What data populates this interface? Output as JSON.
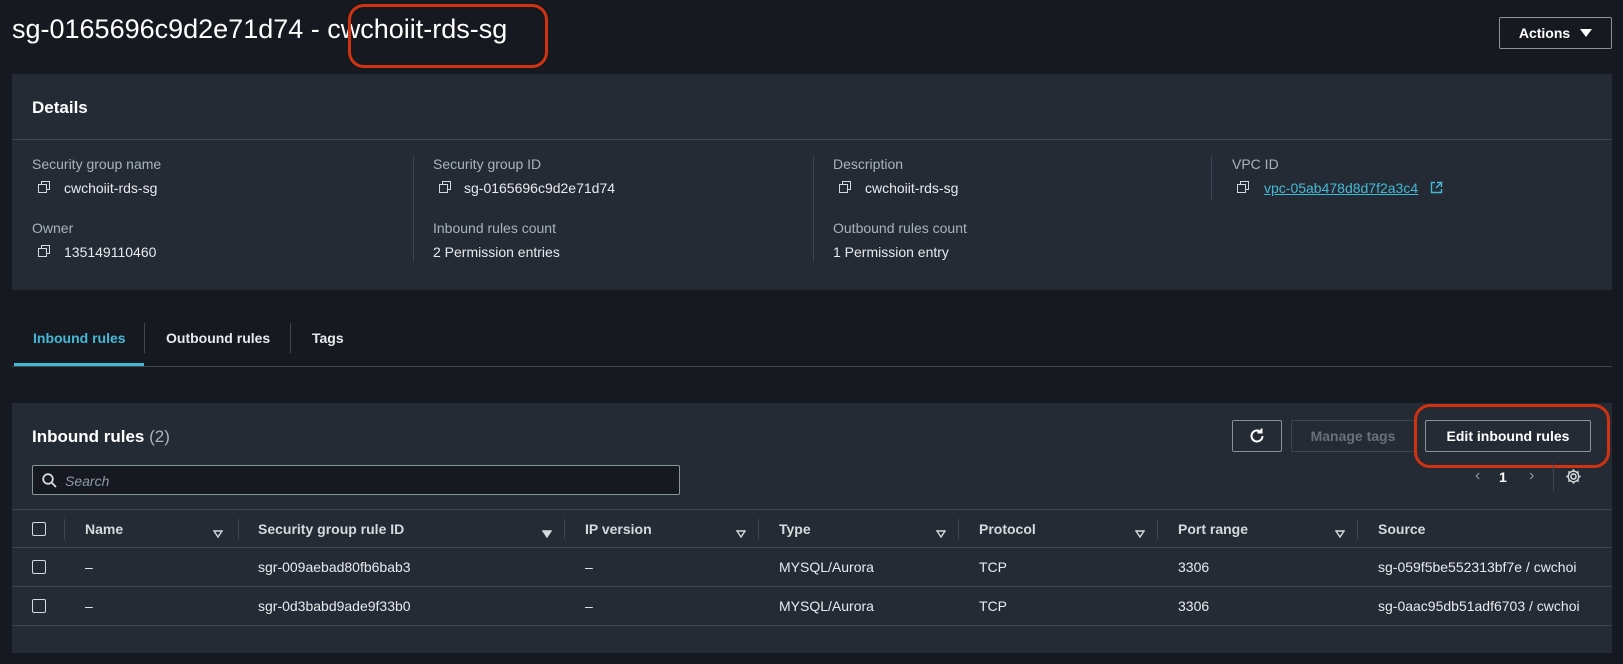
{
  "page": {
    "title_id": "sg-0165696c9d2e71d74 - ",
    "title_name": "cwchoiit-rds-sg",
    "actions_label": "Actions"
  },
  "details": {
    "heading": "Details",
    "fields": [
      {
        "label": "Security group name",
        "value": "cwchoiit-rds-sg"
      },
      {
        "label": "Security group ID",
        "value": "sg-0165696c9d2e71d74"
      },
      {
        "label": "Description",
        "value": "cwchoiit-rds-sg"
      },
      {
        "label": "VPC ID",
        "value": "vpc-05ab478d8d7f2a3c4"
      },
      {
        "label": "Owner",
        "value": "135149110460"
      },
      {
        "label": "Inbound rules count",
        "value": "2 Permission entries"
      },
      {
        "label": "Outbound rules count",
        "value": "1 Permission entry"
      }
    ]
  },
  "tabs": [
    {
      "label": "Inbound rules",
      "active": true
    },
    {
      "label": "Outbound rules",
      "active": false
    },
    {
      "label": "Tags",
      "active": false
    }
  ],
  "inbound": {
    "heading": "Inbound rules",
    "count": "(2)",
    "manage_tags_label": "Manage tags",
    "edit_label": "Edit inbound rules",
    "search_placeholder": "Search",
    "page_number": "1",
    "columns": [
      "Name",
      "Security group rule ID",
      "IP version",
      "Type",
      "Protocol",
      "Port range",
      "Source"
    ],
    "rows": [
      {
        "name": "–",
        "rule_id": "sgr-009aebad80fb6bab3",
        "ip_version": "–",
        "type": "MYSQL/Aurora",
        "protocol": "TCP",
        "port_range": "3306",
        "source": "sg-059f5be552313bf7e / cwchoi"
      },
      {
        "name": "–",
        "rule_id": "sgr-0d3babd9ade9f33b0",
        "ip_version": "–",
        "type": "MYSQL/Aurora",
        "protocol": "TCP",
        "port_range": "3306",
        "source": "sg-0aac95db51adf6703 / cwchoi"
      }
    ]
  },
  "colors": {
    "background": "#16191f",
    "panel": "#252b34",
    "accent": "#44b9d6",
    "highlight": "#d13212"
  }
}
